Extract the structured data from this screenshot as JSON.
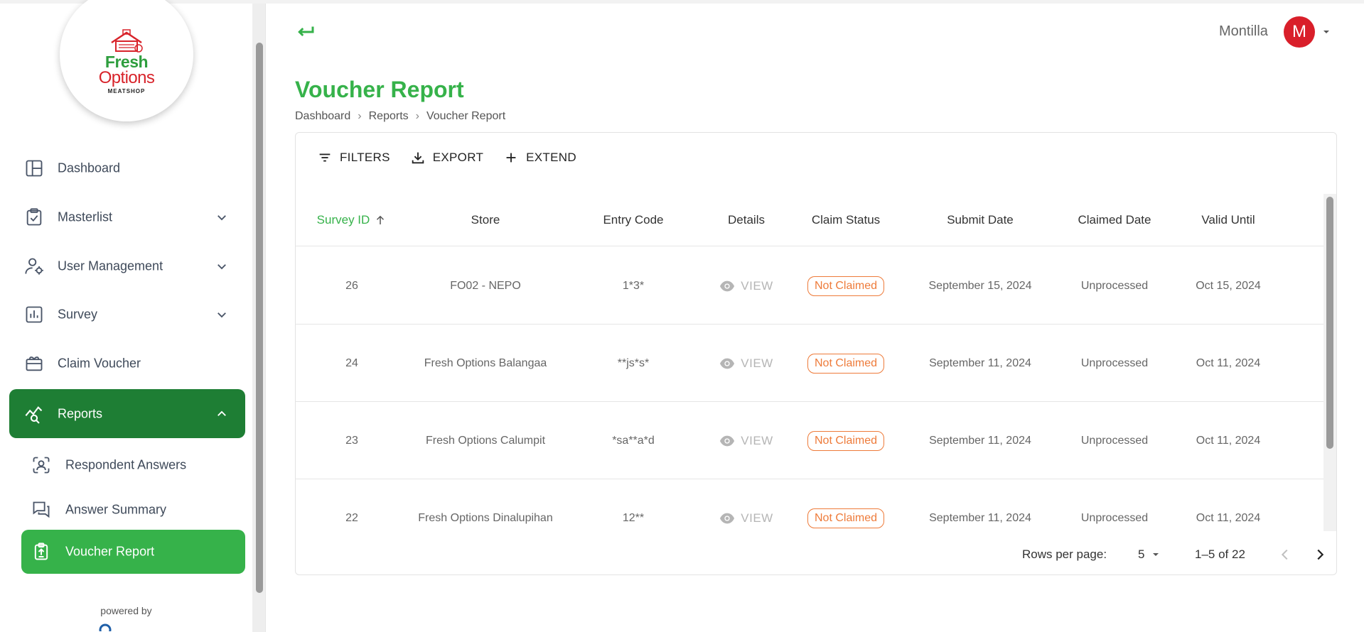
{
  "brand": {
    "logo_line1": "Fresh",
    "logo_line2": "Options",
    "logo_line3": "MEATSHOP"
  },
  "sidebar": {
    "items": [
      {
        "label": "Dashboard",
        "icon": "dashboard-icon"
      },
      {
        "label": "Masterlist",
        "icon": "clipboard-check-icon",
        "expandable": true
      },
      {
        "label": "User Management",
        "icon": "user-settings-icon",
        "expandable": true
      },
      {
        "label": "Survey",
        "icon": "bar-chart-icon",
        "expandable": true
      },
      {
        "label": "Claim Voucher",
        "icon": "gift-card-icon"
      },
      {
        "label": "Reports",
        "icon": "analytics-search-icon",
        "expanded": true,
        "active": true
      }
    ],
    "sub_items": [
      {
        "label": "Respondent Answers",
        "icon": "person-scan-icon"
      },
      {
        "label": "Answer Summary",
        "icon": "chat-bubbles-icon"
      },
      {
        "label": "Voucher Report",
        "icon": "clipboard-upload-icon",
        "active": true
      }
    ],
    "powered_by": "powered by"
  },
  "header": {
    "user_name": "Montilla",
    "avatar_initial": "M"
  },
  "page": {
    "title": "Voucher Report",
    "breadcrumb": [
      "Dashboard",
      "Reports",
      "Voucher Report"
    ],
    "breadcrumb_sep": "›"
  },
  "toolbar": {
    "filters": "FILTERS",
    "export": "EXPORT",
    "extend": "EXTEND"
  },
  "table": {
    "columns": [
      "Survey ID",
      "Store",
      "Entry Code",
      "Details",
      "Claim Status",
      "Submit Date",
      "Claimed Date",
      "Valid Until"
    ],
    "view_label": "VIEW",
    "rows": [
      {
        "id": "26",
        "store": "FO02 - NEPO",
        "code": "1*3*",
        "status": "Not Claimed",
        "submit": "September 15, 2024",
        "claimed": "Unprocessed",
        "valid": "Oct 15, 2024"
      },
      {
        "id": "24",
        "store": "Fresh Options Balangaa",
        "code": "**js*s*",
        "status": "Not Claimed",
        "submit": "September 11, 2024",
        "claimed": "Unprocessed",
        "valid": "Oct 11, 2024"
      },
      {
        "id": "23",
        "store": "Fresh Options Calumpit",
        "code": "*sa**a*d",
        "status": "Not Claimed",
        "submit": "September 11, 2024",
        "claimed": "Unprocessed",
        "valid": "Oct 11, 2024"
      },
      {
        "id": "22",
        "store": "Fresh Options Dinalupihan",
        "code": "12**",
        "status": "Not Claimed",
        "submit": "September 11, 2024",
        "claimed": "Unprocessed",
        "valid": "Oct 11, 2024"
      }
    ]
  },
  "pagination": {
    "rows_per_page_label": "Rows per page:",
    "rows_per_page": "5",
    "range": "1–5 of 22"
  },
  "colors": {
    "brand_green": "#36b24a",
    "active_parent": "#1e7e34",
    "status_orange": "#ee7b3a",
    "avatar_red": "#d91f2a"
  }
}
